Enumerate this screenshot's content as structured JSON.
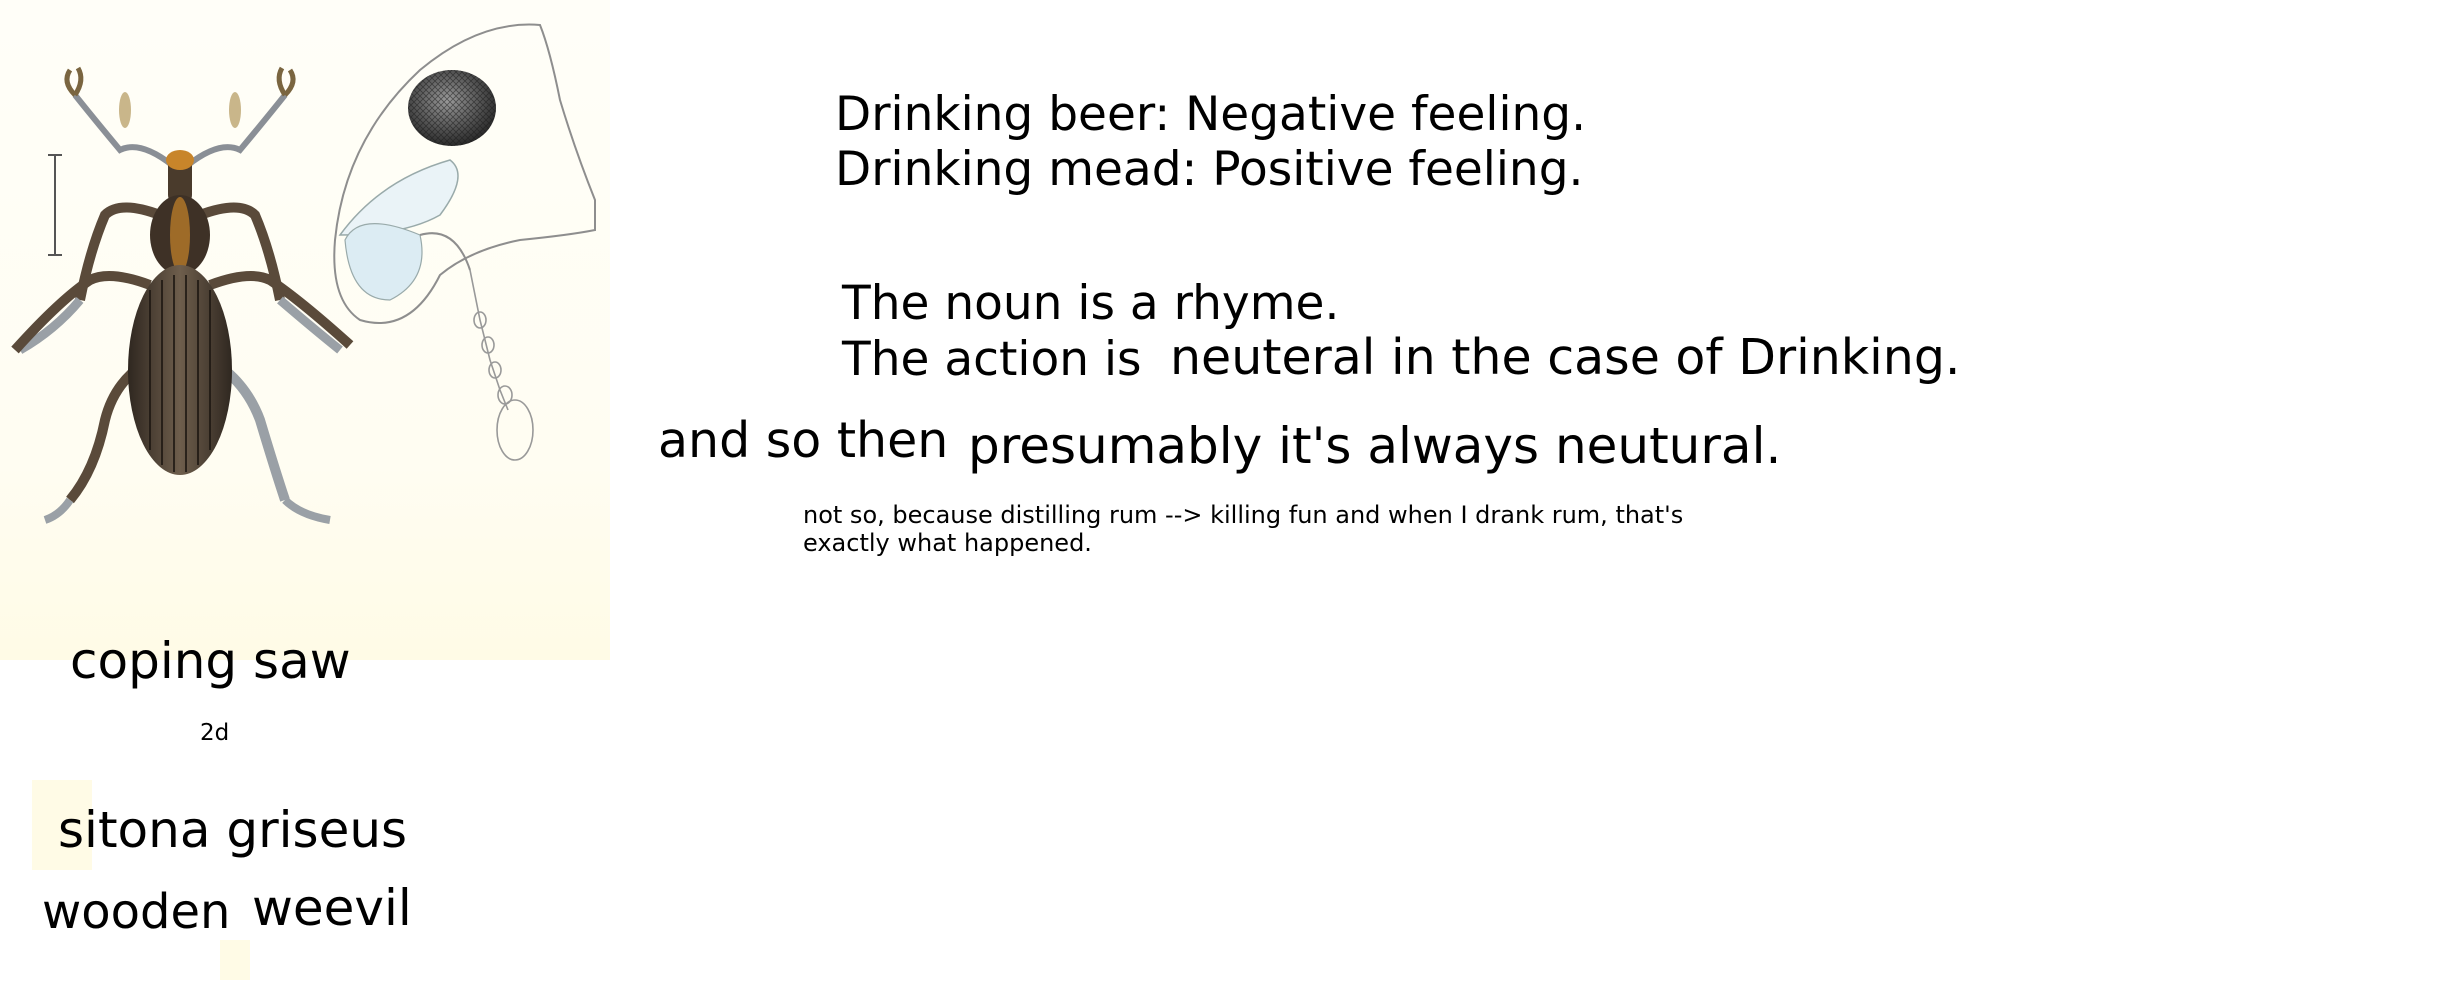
{
  "illustration": {
    "icon": "weevil-plate-icon",
    "accent": "#3e3126",
    "highlight": "#c8852a",
    "paper": "#fffdf2"
  },
  "labels": {
    "beer": "Drinking beer: Negative feeling.",
    "mead": "Drinking mead: Positive feeling.",
    "noun": "The noun is a rhyme.",
    "action_prefix": "The action is",
    "action_suffix": "neuteral in the case of Drinking.",
    "so_then": "and so then",
    "presumably": "presumably it's always neutural.",
    "note_line1": "not so, because distilling rum --> killing fun and when I drank rum, that's",
    "note_line2": "exactly what happened.",
    "coping_saw": "coping saw",
    "code": "2d",
    "species": "sitona griseus",
    "wooden": "wooden",
    "weevil": "weevil"
  }
}
